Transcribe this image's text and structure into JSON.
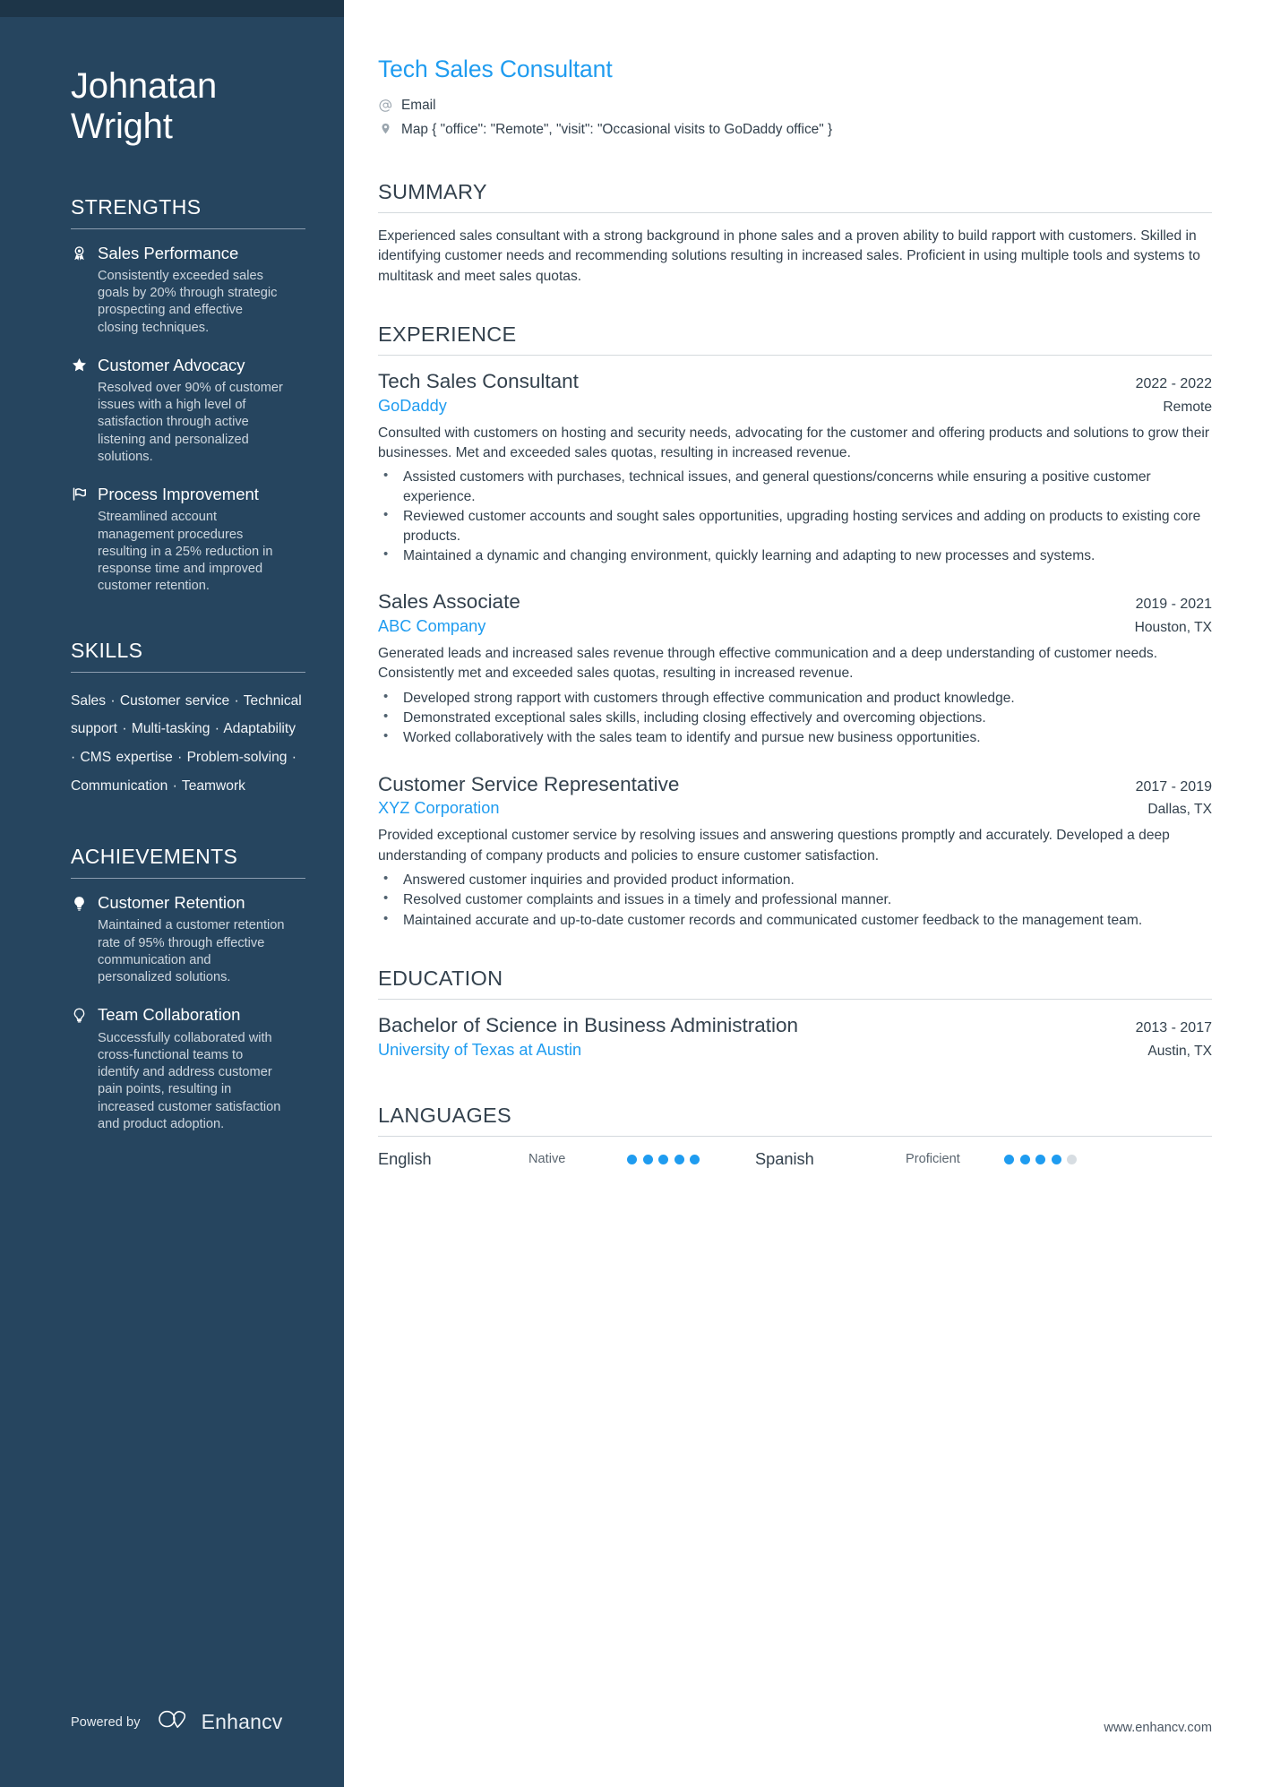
{
  "sidebar": {
    "name": "Johnatan Wright",
    "strengths": {
      "title": "STRENGTHS",
      "items": [
        {
          "icon": "award-ribbon-icon",
          "title": "Sales Performance",
          "desc": "Consistently exceeded sales goals by 20% through strategic prospecting and effective closing techniques."
        },
        {
          "icon": "star-icon",
          "title": "Customer Advocacy",
          "desc": "Resolved over 90% of customer issues with a high level of satisfaction through active listening and personalized solutions."
        },
        {
          "icon": "flag-icon",
          "title": "Process Improvement",
          "desc": "Streamlined account management procedures resulting in a 25% reduction in response time and improved customer retention."
        }
      ]
    },
    "skills": {
      "title": "SKILLS",
      "text": "Sales · Customer service · Technical support · Multi-tasking · Adaptability · CMS expertise · Problem-solving · Communication · Teamwork",
      "list": [
        "Sales",
        "Customer service",
        "Technical support",
        "Multi-tasking",
        "Adaptability",
        "CMS expertise",
        "Problem-solving",
        "Communication",
        "Teamwork"
      ]
    },
    "achievements": {
      "title": "ACHIEVEMENTS",
      "items": [
        {
          "icon": "lightbulb-filled-icon",
          "title": "Customer Retention",
          "desc": "Maintained a customer retention rate of 95% through effective communication and personalized solutions."
        },
        {
          "icon": "lightbulb-outline-icon",
          "title": "Team Collaboration",
          "desc": "Successfully collaborated with cross-functional teams to identify and address customer pain points, resulting in increased customer satisfaction and product adoption."
        }
      ]
    },
    "footer": {
      "powered_by": "Powered by",
      "brand": "Enhancv"
    }
  },
  "main": {
    "headline": "Tech Sales Consultant",
    "contacts": [
      {
        "icon": "at-email-icon",
        "text": "Email"
      },
      {
        "icon": "map-pin-icon",
        "text": "Map { \"office\": \"Remote\", \"visit\": \"Occasional visits to GoDaddy office\" }"
      }
    ],
    "summary": {
      "title": "SUMMARY",
      "text": "Experienced sales consultant with a strong background in phone sales and a proven ability to build rapport with customers. Skilled in identifying customer needs and recommending solutions resulting in increased sales. Proficient in using multiple tools and systems to multitask and meet sales quotas."
    },
    "experience": {
      "title": "EXPERIENCE",
      "entries": [
        {
          "role": "Tech Sales Consultant",
          "date": "2022 - 2022",
          "org": "GoDaddy",
          "location": "Remote",
          "desc": "Consulted with customers on hosting and security needs, advocating for the customer and offering products and solutions to grow their businesses. Met and exceeded sales quotas, resulting in increased revenue.",
          "bullets": [
            "Assisted customers with purchases, technical issues, and general questions/concerns while ensuring a positive customer experience.",
            "Reviewed customer accounts and sought sales opportunities, upgrading hosting services and adding on products to existing core products.",
            "Maintained a dynamic and changing environment, quickly learning and adapting to new processes and systems."
          ]
        },
        {
          "role": "Sales Associate",
          "date": "2019 - 2021",
          "org": "ABC Company",
          "location": "Houston, TX",
          "desc": "Generated leads and increased sales revenue through effective communication and a deep understanding of customer needs. Consistently met and exceeded sales quotas, resulting in increased revenue.",
          "bullets": [
            "Developed strong rapport with customers through effective communication and product knowledge.",
            "Demonstrated exceptional sales skills, including closing effectively and overcoming objections.",
            "Worked collaboratively with the sales team to identify and pursue new business opportunities."
          ]
        },
        {
          "role": "Customer Service Representative",
          "date": "2017 - 2019",
          "org": "XYZ Corporation",
          "location": "Dallas, TX",
          "desc": "Provided exceptional customer service by resolving issues and answering questions promptly and accurately. Developed a deep understanding of company products and policies to ensure customer satisfaction.",
          "bullets": [
            "Answered customer inquiries and provided product information.",
            "Resolved customer complaints and issues in a timely and professional manner.",
            "Maintained accurate and up-to-date customer records and communicated customer feedback to the management team."
          ]
        }
      ]
    },
    "education": {
      "title": "EDUCATION",
      "entries": [
        {
          "degree": "Bachelor of Science in Business Administration",
          "date": "2013 - 2017",
          "school": "University of Texas at Austin",
          "location": "Austin, TX"
        }
      ]
    },
    "languages": {
      "title": "LANGUAGES",
      "items": [
        {
          "name": "English",
          "level": "Native",
          "filled": 5,
          "total": 5
        },
        {
          "name": "Spanish",
          "level": "Proficient",
          "filled": 4,
          "total": 5
        }
      ]
    },
    "website": "www.enhancv.com"
  },
  "colors": {
    "sidebar_bg": "#26455f",
    "sidebar_topbar": "#1d3548",
    "accent_blue": "#1f9cf0",
    "body_text": "#33414d",
    "muted_text": "#cdd6de"
  }
}
